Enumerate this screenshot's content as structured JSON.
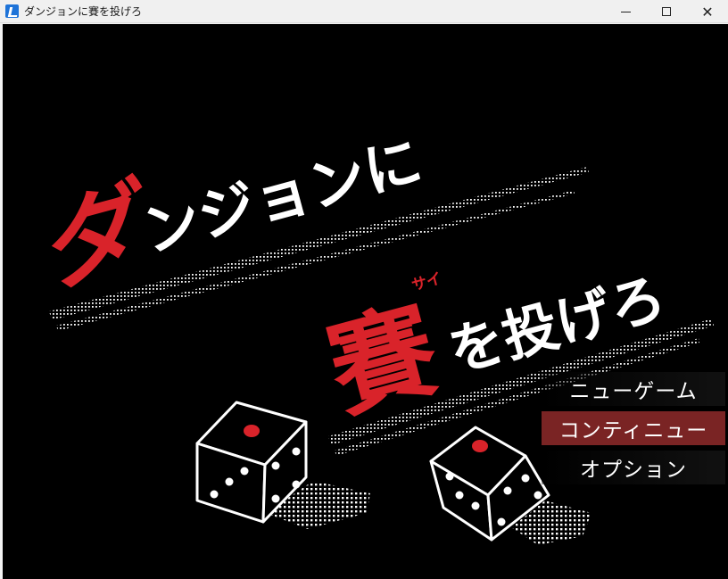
{
  "window": {
    "title": "ダンジョンに賽を投げろ",
    "min_symbol": "—",
    "max_symbol": "☐",
    "close_symbol": "✕"
  },
  "logo": {
    "line1_first_char": "ダ",
    "line1_rest": "ンジョンに",
    "line2_kanji": "賽",
    "line2_rest": "を投げろ",
    "ruby": "サイ"
  },
  "menu": {
    "items": [
      {
        "label": "ニューゲーム",
        "selected": false
      },
      {
        "label": "コンティニュー",
        "selected": true
      },
      {
        "label": "オプション",
        "selected": false
      }
    ]
  },
  "colors": {
    "accent_red": "#d9232a",
    "selected_menu": "#7a2424",
    "background": "#000000"
  }
}
